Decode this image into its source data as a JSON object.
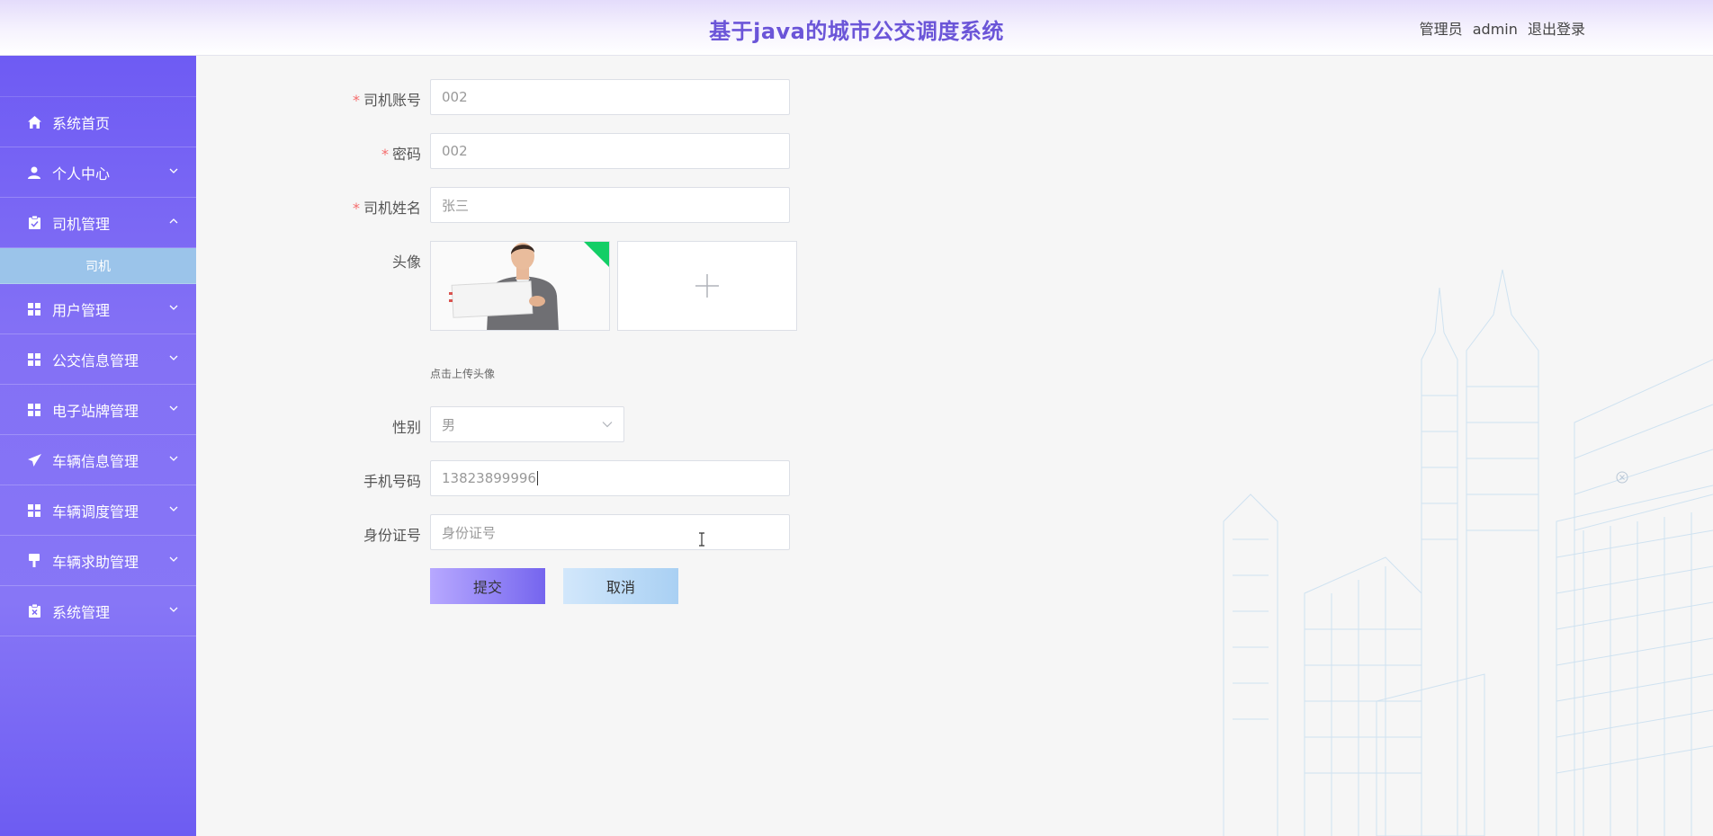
{
  "header": {
    "title": "基于java的城市公交调度系统",
    "user_role": "管理员",
    "username": "admin",
    "logout_label": "退出登录"
  },
  "sidebar": {
    "items": [
      {
        "label": "系统首页",
        "icon": "home-icon",
        "expandable": false
      },
      {
        "label": "个人中心",
        "icon": "user-icon",
        "expandable": true,
        "expanded": false
      },
      {
        "label": "司机管理",
        "icon": "clipboard-icon",
        "expandable": true,
        "expanded": true,
        "children": [
          "司机"
        ]
      },
      {
        "label": "用户管理",
        "icon": "grid-icon",
        "expandable": true,
        "expanded": false
      },
      {
        "label": "公交信息管理",
        "icon": "grid-icon",
        "expandable": true,
        "expanded": false
      },
      {
        "label": "电子站牌管理",
        "icon": "grid-icon",
        "expandable": true,
        "expanded": false
      },
      {
        "label": "车辆信息管理",
        "icon": "send-icon",
        "expandable": true,
        "expanded": false
      },
      {
        "label": "车辆调度管理",
        "icon": "grid-icon",
        "expandable": true,
        "expanded": false
      },
      {
        "label": "车辆求助管理",
        "icon": "stamp-icon",
        "expandable": true,
        "expanded": false
      },
      {
        "label": "系统管理",
        "icon": "clipboard-x-icon",
        "expandable": true,
        "expanded": false
      }
    ]
  },
  "form": {
    "account": {
      "label": "司机账号",
      "value": "002",
      "required": true
    },
    "password": {
      "label": "密码",
      "value": "002",
      "required": true
    },
    "name": {
      "label": "司机姓名",
      "value": "张三",
      "required": true
    },
    "avatar": {
      "label": "头像",
      "note": "点击上传头像"
    },
    "gender": {
      "label": "性别",
      "value": "男"
    },
    "phone": {
      "label": "手机号码",
      "value": "13823899996"
    },
    "id_card": {
      "label": "身份证号",
      "placeholder": "身份证号"
    },
    "submit_label": "提交",
    "cancel_label": "取消"
  },
  "colors": {
    "accent": "#6b55d8",
    "sidebar_top": "#6e5bf3",
    "submenu_active": "#9bc4ea",
    "required": "#f56c6c",
    "upload_badge": "#13ce66"
  }
}
